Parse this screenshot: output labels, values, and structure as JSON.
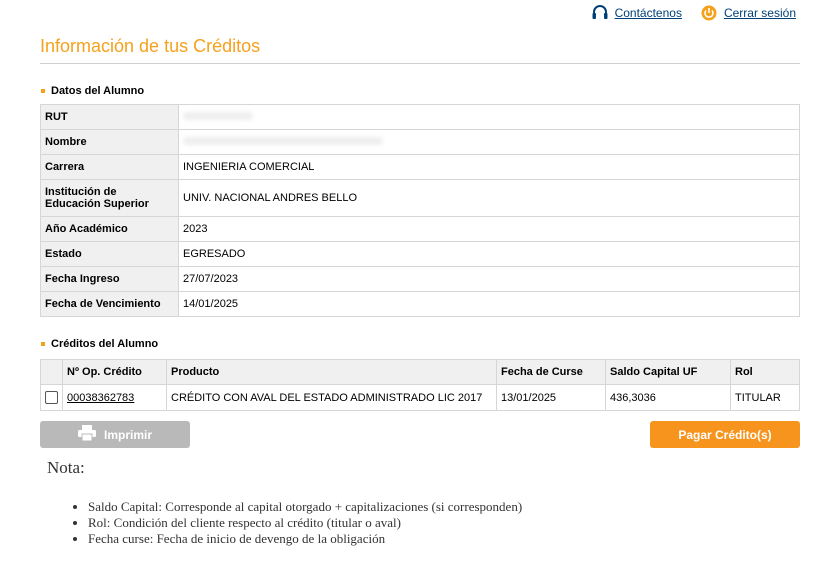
{
  "header": {
    "contact_label": "Contáctenos",
    "logout_label": "Cerrar sesión",
    "icons": [
      "headset-icon",
      "power-icon"
    ]
  },
  "page_title": "Información de tus Créditos",
  "alumno": {
    "section_title": "Datos del Alumno",
    "rows": [
      {
        "label": "RUT",
        "value": ""
      },
      {
        "label": "Nombre",
        "value": ""
      },
      {
        "label": "Carrera",
        "value": "INGENIERIA COMERCIAL"
      },
      {
        "label": "Institución de Educación Superior",
        "value": "UNIV. NACIONAL ANDRES BELLO"
      },
      {
        "label": "Año Académico",
        "value": "2023"
      },
      {
        "label": "Estado",
        "value": "EGRESADO"
      },
      {
        "label": "Fecha Ingreso",
        "value": "27/07/2023"
      },
      {
        "label": "Fecha de Vencimiento",
        "value": "14/01/2025"
      }
    ]
  },
  "creditos": {
    "section_title": "Créditos del Alumno",
    "columns": [
      "Nº Op. Crédito",
      "Producto",
      "Fecha de Curse",
      "Saldo Capital UF",
      "Rol"
    ],
    "rows": [
      {
        "op": "00038362783",
        "producto": "CRÉDITO CON AVAL DEL ESTADO ADMINISTRADO LIC 2017",
        "fecha_curse": "13/01/2025",
        "saldo_uf": "436,3036",
        "rol": "TITULAR",
        "checked": false
      }
    ]
  },
  "actions": {
    "print_label": "Imprimir",
    "pay_label": "Pagar Crédito(s)"
  },
  "nota": {
    "title": "Nota:",
    "items": [
      "Saldo Capital: Corresponde al capital otorgado + capitalizaciones (si corresponden)",
      "Rol: Condición del cliente respecto al crédito (titular o aval)",
      "Fecha curse: Fecha de inicio de devengo de la obligación"
    ]
  },
  "colors": {
    "accent": "#f5a11c",
    "pay_button": "#f7941d",
    "print_button_disabled": "#b9b9b9",
    "link": "#00407a",
    "label_bg": "#f0f0f0"
  }
}
